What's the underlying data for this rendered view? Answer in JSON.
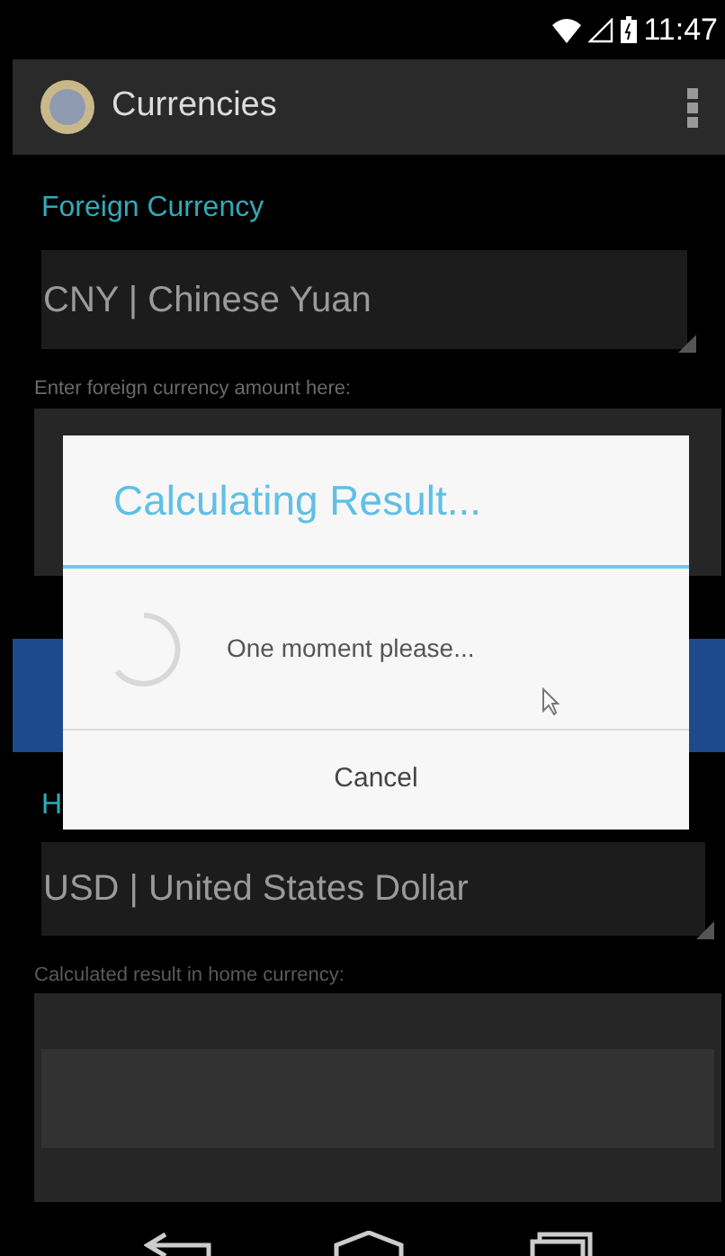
{
  "status_bar": {
    "time": "11:47"
  },
  "app_bar": {
    "title": "Currencies"
  },
  "foreign": {
    "heading": "Foreign Currency",
    "currency": "CNY | Chinese Yuan",
    "amount_label": "Enter foreign currency amount here:"
  },
  "home": {
    "heading": "H",
    "currency": "USD | United States Dollar",
    "result_label": "Calculated result in home currency:"
  },
  "dialog": {
    "title": "Calculating Result...",
    "message": "One moment please...",
    "buttons": [
      "Cancel"
    ]
  }
}
